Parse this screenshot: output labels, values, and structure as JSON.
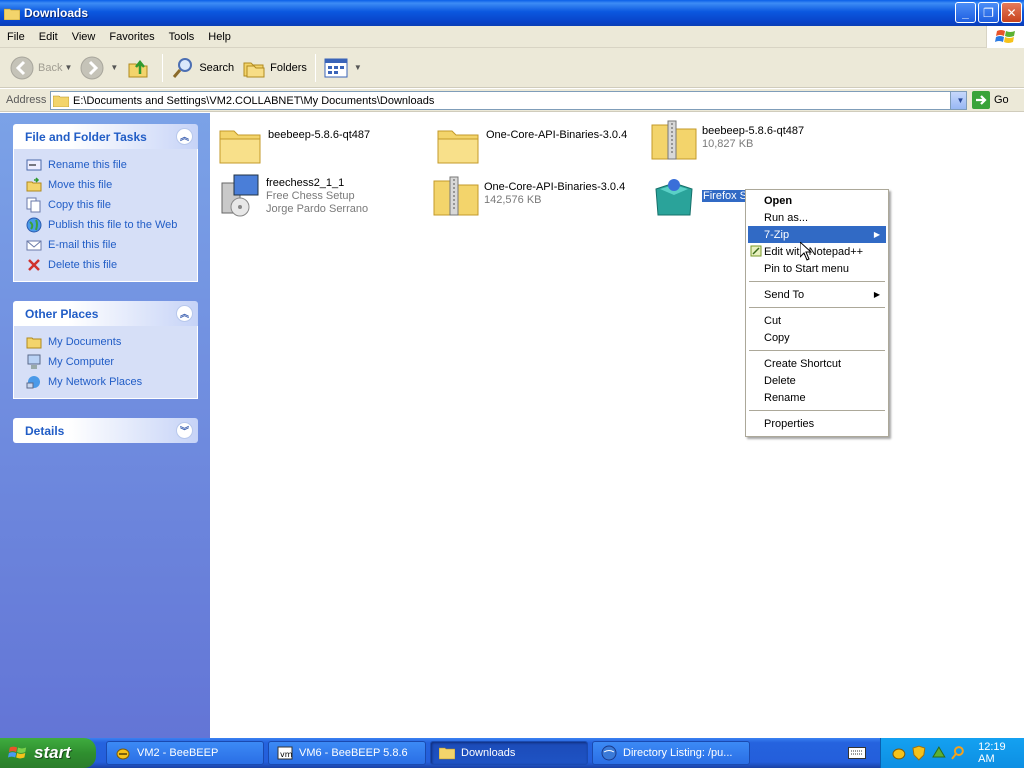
{
  "window": {
    "title": "Downloads"
  },
  "menu": [
    "File",
    "Edit",
    "View",
    "Favorites",
    "Tools",
    "Help"
  ],
  "toolbar": {
    "back": "Back",
    "search": "Search",
    "folders": "Folders"
  },
  "address": {
    "label": "Address",
    "path": "E:\\Documents and Settings\\VM2.COLLABNET\\My Documents\\Downloads",
    "go": "Go"
  },
  "panels": {
    "tasks": {
      "title": "File and Folder Tasks",
      "items": [
        "Rename this file",
        "Move this file",
        "Copy this file",
        "Publish this file to the Web",
        "E-mail this file",
        "Delete this file"
      ]
    },
    "places": {
      "title": "Other Places",
      "items": [
        "My Documents",
        "My Computer",
        "My Network Places"
      ]
    },
    "details": {
      "title": "Details"
    }
  },
  "files": [
    {
      "name": "beebeep-5.8.6-qt487",
      "sub1": "",
      "sub2": ""
    },
    {
      "name": "One-Core-API-Binaries-3.0.4",
      "sub1": "",
      "sub2": ""
    },
    {
      "name": "beebeep-5.8.6-qt487",
      "sub1": "10,827 KB",
      "sub2": ""
    },
    {
      "name": "freechess2_1_1",
      "sub1": "Free Chess Setup",
      "sub2": "Jorge Pardo Serrano"
    },
    {
      "name": "One-Core-API-Binaries-3.0.4",
      "sub1": "142,576 KB",
      "sub2": ""
    },
    {
      "name": "Firefox S",
      "sub1": "",
      "sub2": ""
    }
  ],
  "context_menu": {
    "items": [
      "Open",
      "Run as...",
      "7-Zip",
      "Edit with Notepad++",
      "Pin to Start menu",
      "Send To",
      "Cut",
      "Copy",
      "Create Shortcut",
      "Delete",
      "Rename",
      "Properties"
    ]
  },
  "taskbar": {
    "start": "start",
    "tasks": [
      "VM2 - BeeBEEP",
      "VM6 - BeeBEEP 5.8.6",
      "Downloads",
      "Directory Listing: /pu..."
    ],
    "clock": "12:19 AM"
  },
  "colors": {
    "title_blue": "#0b58df",
    "highlight": "#316ac5",
    "panel_link": "#215dc6",
    "start_green": "#2f8f2f"
  }
}
